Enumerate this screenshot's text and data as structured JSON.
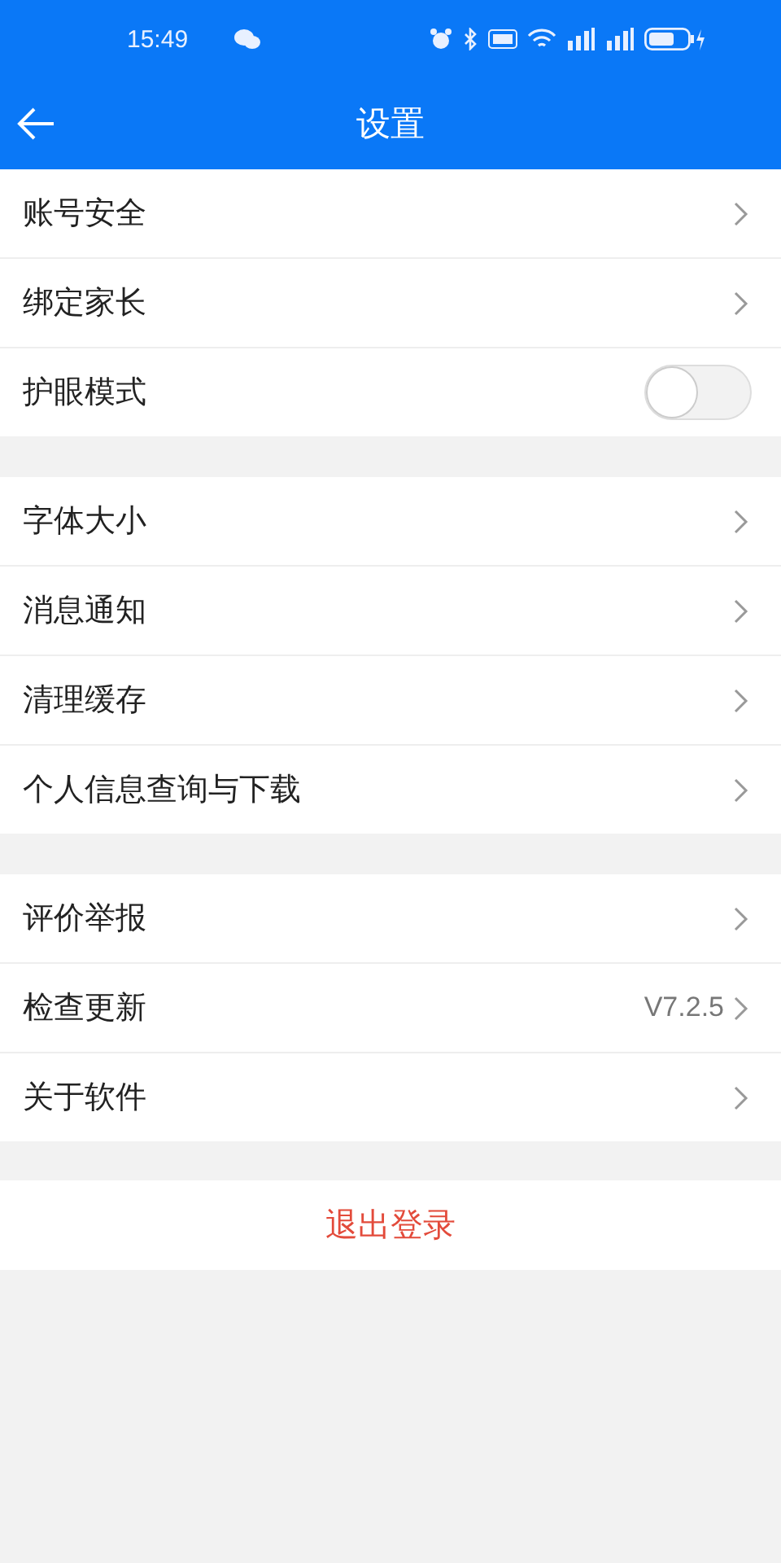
{
  "status_bar": {
    "time": "15:49"
  },
  "header": {
    "title": "设置"
  },
  "groups": [
    {
      "items": [
        {
          "kind": "link",
          "label": "账号安全"
        },
        {
          "kind": "link",
          "label": "绑定家长"
        },
        {
          "kind": "toggle",
          "label": "护眼模式",
          "on": false
        }
      ]
    },
    {
      "items": [
        {
          "kind": "link",
          "label": "字体大小"
        },
        {
          "kind": "link",
          "label": "消息通知"
        },
        {
          "kind": "link",
          "label": "清理缓存"
        },
        {
          "kind": "link",
          "label": "个人信息查询与下载"
        }
      ]
    },
    {
      "items": [
        {
          "kind": "link",
          "label": "评价举报"
        },
        {
          "kind": "link",
          "label": "检查更新",
          "value": "V7.2.5"
        },
        {
          "kind": "link",
          "label": "关于软件"
        }
      ]
    }
  ],
  "logout_button": "退出登录"
}
